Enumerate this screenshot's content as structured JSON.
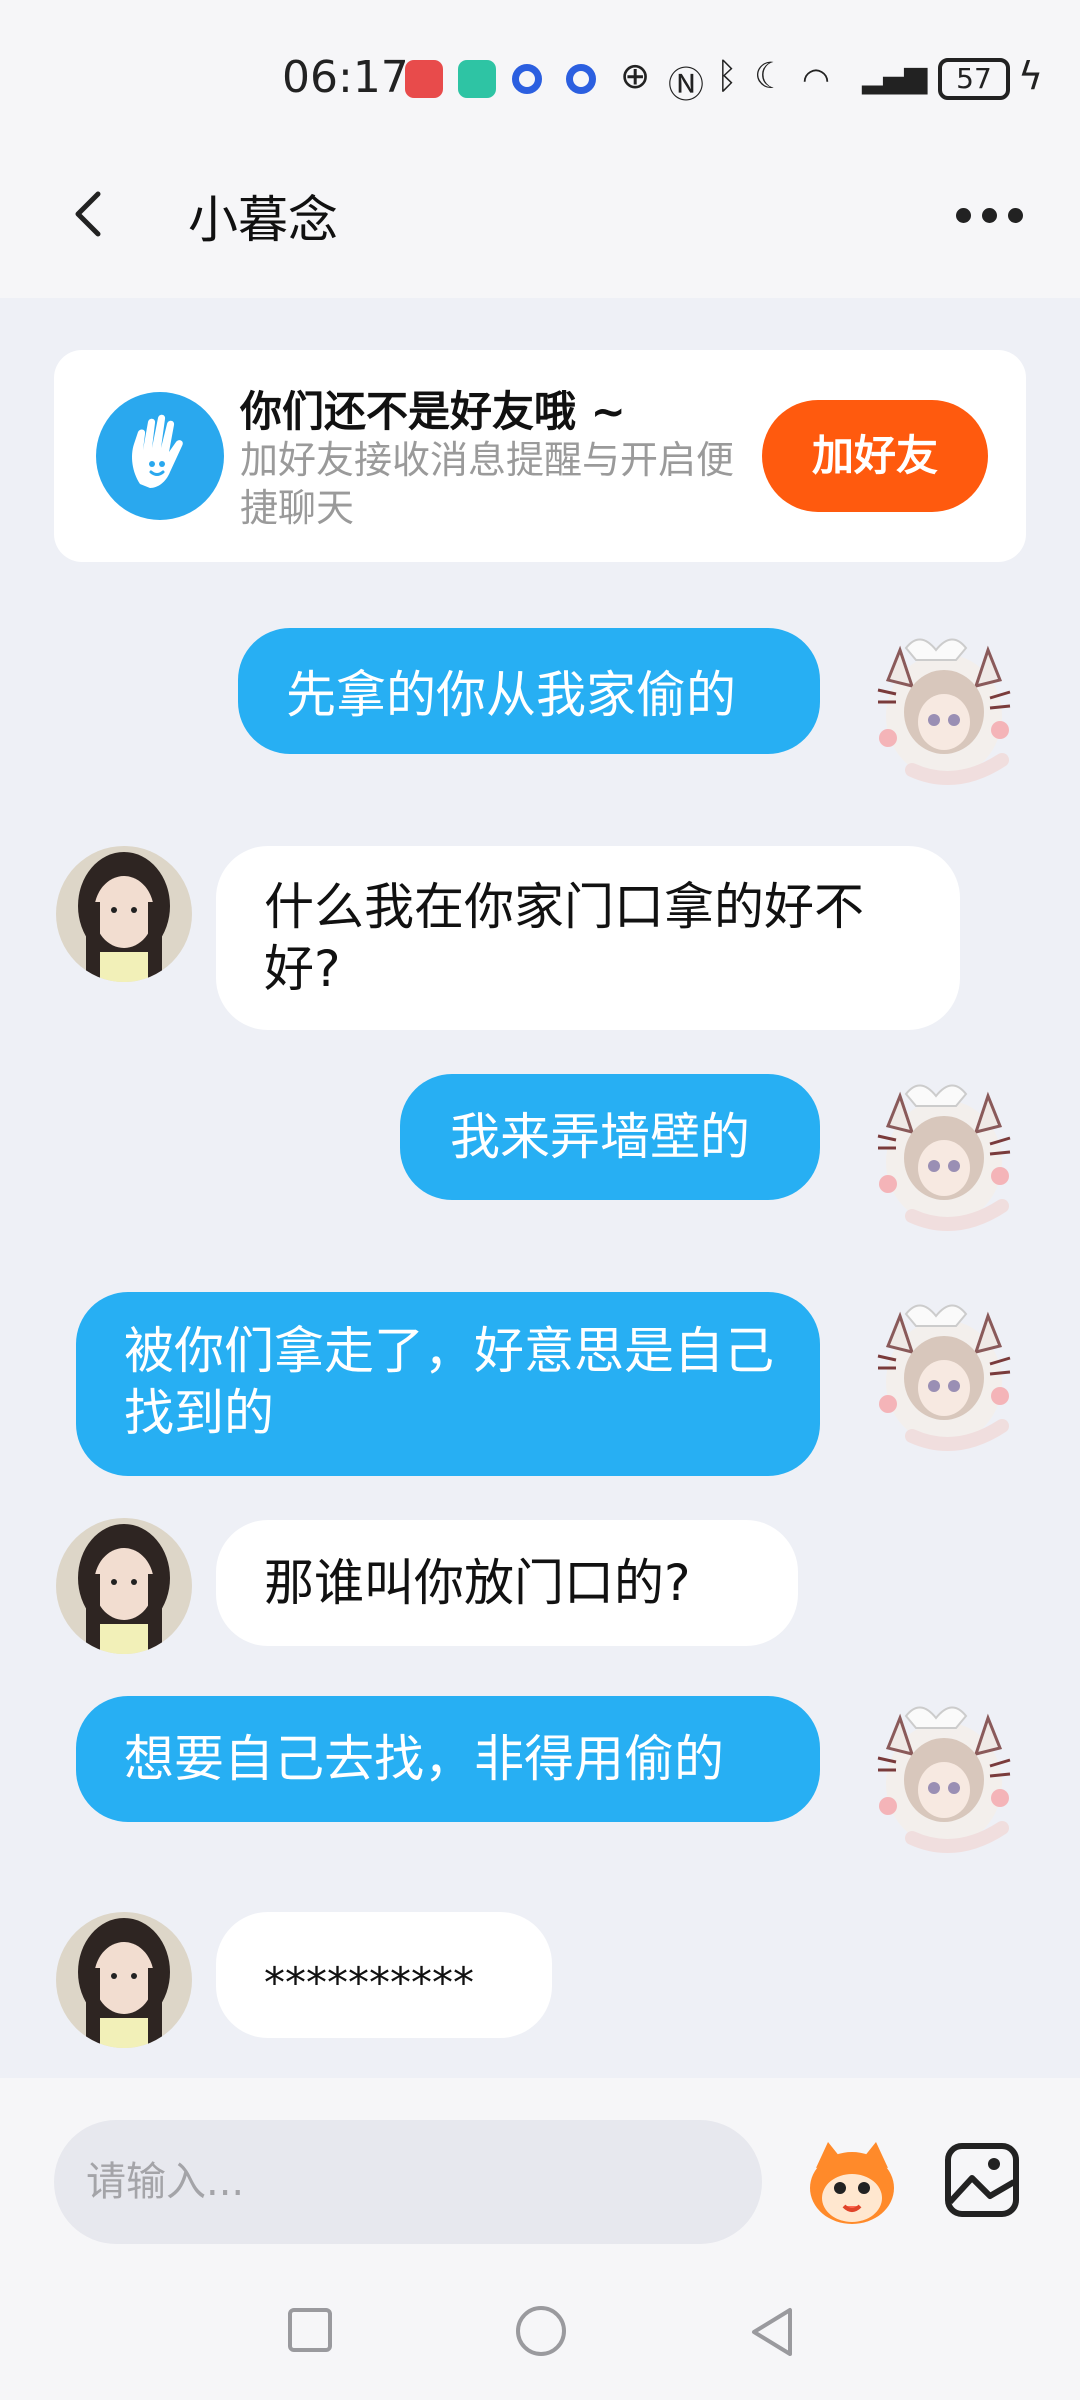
{
  "status_bar": {
    "time": "06:17",
    "battery": "57",
    "icons": [
      "huawei-app-icon",
      "shield-icon",
      "circle-app-icon",
      "circle-app-icon",
      "hd-icon",
      "nfc-icon",
      "bluetooth-icon",
      "moon-icon",
      "wifi-icon",
      "5g-signal-icon",
      "charging-icon"
    ]
  },
  "header": {
    "title": "小暮念",
    "back_icon": "chevron-left-icon",
    "more_icon": "more-dots-icon"
  },
  "friend_banner": {
    "title": "你们还不是好友哦 ~",
    "subtitle": "加好友接收消息提醒与开启便捷聊天",
    "button_label": "加好友",
    "icon": "wave-hand-icon",
    "accent": "#ff5a0e"
  },
  "messages": [
    {
      "from": "me",
      "text": "先拿的你从我家偷的"
    },
    {
      "from": "them",
      "text": "什么我在你家门口拿的好不好?"
    },
    {
      "from": "me",
      "text": "我来弄墙壁的"
    },
    {
      "from": "me",
      "text": "被你们拿走了，好意思是自己找到的"
    },
    {
      "from": "them",
      "text": "那谁叫你放门口的?"
    },
    {
      "from": "me",
      "text": "想要自己去找，非得用偷的"
    },
    {
      "from": "them",
      "text": "**********"
    }
  ],
  "input_bar": {
    "placeholder": "请输入...",
    "sticker_icon": "mascot-sticker-icon",
    "image_icon": "image-icon"
  },
  "colors": {
    "my_bubble": "#27aff3",
    "their_bubble": "#ffffff",
    "background": "#eef0f6"
  }
}
